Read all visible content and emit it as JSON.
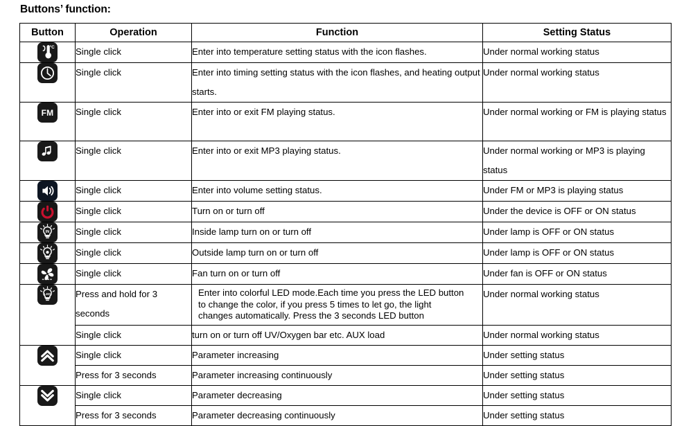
{
  "page": {
    "title": "Buttons’ function:"
  },
  "table": {
    "headers": {
      "button": "Button",
      "operation": "Operation",
      "function": "Function",
      "setting_status": "Setting Status"
    },
    "rows": [
      {
        "icon": "thermometer-icon",
        "icon_kind": "thermometer",
        "operation": "Single click",
        "function": "Enter into temperature setting status with the icon flashes.",
        "setting_status": "Under normal working status"
      },
      {
        "icon": "clock-icon",
        "icon_kind": "clock",
        "operation": "Single click",
        "function": "Enter into timing setting status with the icon flashes, and heating output starts.",
        "setting_status": "Under normal working status"
      },
      {
        "icon": "fm-icon",
        "icon_kind": "fm",
        "icon_label": "FM",
        "operation": "Single click",
        "function": "Enter into or exit FM playing status.",
        "setting_status": "Under normal working or FM is playing status"
      },
      {
        "icon": "music-note-icon",
        "icon_kind": "music",
        "operation": "Single click",
        "function": "Enter into or exit MP3 playing status.",
        "setting_status": "Under normal working or MP3 is playing status"
      },
      {
        "icon": "speaker-volume-icon",
        "icon_kind": "speaker",
        "operation": "Single click",
        "function": "Enter into volume setting status.",
        "setting_status": "Under FM or MP3 is playing status"
      },
      {
        "icon": "power-icon",
        "icon_kind": "power",
        "operation": "Single click",
        "function": "Turn on or turn off",
        "setting_status": "Under the device is OFF or ON status"
      },
      {
        "icon": "inside-lamp-icon",
        "icon_kind": "lamp",
        "icon_label": "IN",
        "operation": "Single click",
        "function": "Inside lamp turn on or turn off",
        "setting_status": "Under lamp is OFF or ON status"
      },
      {
        "icon": "outside-lamp-icon",
        "icon_kind": "lamp",
        "icon_label": "",
        "operation": "Single click",
        "function": "Outside lamp turn on or turn off",
        "setting_status": "Under lamp is OFF or ON status"
      },
      {
        "icon": "fan-icon",
        "icon_kind": "fan",
        "operation": "Single click",
        "function": "Fan turn on or turn off",
        "setting_status": "Under fan is OFF or ON status"
      }
    ],
    "led_row": {
      "icon": "led-lamp-icon",
      "icon_kind": "lamp",
      "icon_label": "LED",
      "sub_rows": [
        {
          "operation": "Press and hold for 3 seconds",
          "function_lines": [
            "Enter into colorful LED mode.Each time you press the LED button",
            "to change the color, if you press 5 times to let go, the light",
            "changes automatically. Press the 3 seconds LED button"
          ],
          "setting_status": "Under normal working status"
        },
        {
          "operation": "Single click",
          "function": "turn on or turn off UV/Oxygen bar etc. AUX load",
          "setting_status": "Under normal working status"
        }
      ]
    },
    "up_row": {
      "icon": "double-chevron-up-icon",
      "icon_kind": "chevron-up",
      "sub_rows": [
        {
          "operation": "Single click",
          "function": "Parameter increasing",
          "setting_status": "Under setting status"
        },
        {
          "operation": "Press for 3 seconds",
          "function": "Parameter increasing continuously",
          "setting_status": "Under setting status"
        }
      ]
    },
    "down_row": {
      "icon": "double-chevron-down-icon",
      "icon_kind": "chevron-down",
      "sub_rows": [
        {
          "operation": "Single click",
          "function": "Parameter decreasing",
          "setting_status": "Under setting status"
        },
        {
          "operation": "Press for 3 seconds",
          "function": "Parameter decreasing continuously",
          "setting_status": "Under setting status"
        }
      ]
    }
  },
  "colors": {
    "chip_background": "#191919",
    "power_red": "#c8102e",
    "border": "#000000",
    "sub_border": "#9a9a9a"
  }
}
